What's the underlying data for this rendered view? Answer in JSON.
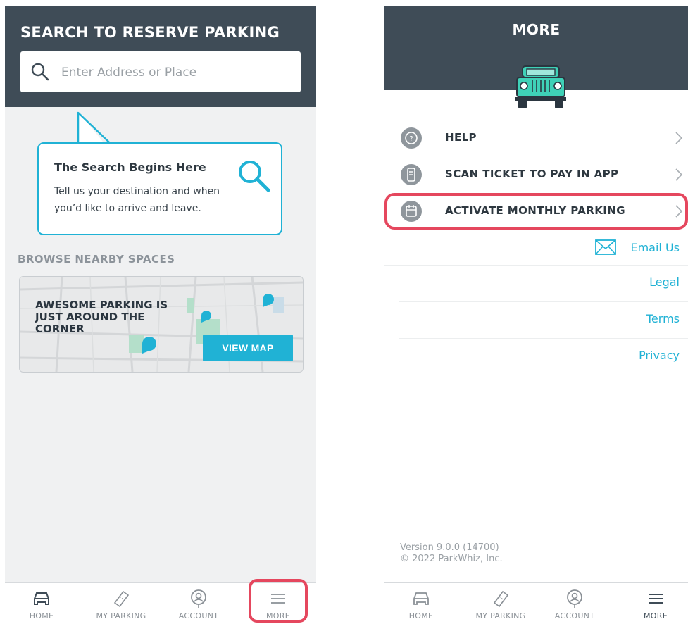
{
  "left": {
    "header_title": "SEARCH TO RESERVE PARKING",
    "search_placeholder": "Enter Address or Place",
    "tip_title": "The Search Begins Here",
    "tip_text": "Tell us your destination and when you’d like to arrive and leave.",
    "browse_title": "BROWSE NEARBY SPACES",
    "map_headline": "AWESOME PARKING IS JUST AROUND THE CORNER",
    "view_map_label": "VIEW MAP"
  },
  "right": {
    "header_title": "MORE",
    "menu": [
      {
        "label": "HELP",
        "icon": "help-icon"
      },
      {
        "label": "SCAN TICKET TO PAY IN APP",
        "icon": "scan-ticket-icon"
      },
      {
        "label": "ACTIVATE MONTHLY PARKING",
        "icon": "monthly-parking-icon"
      }
    ],
    "email_label": "Email Us",
    "links": [
      "Legal",
      "Terms",
      "Privacy"
    ],
    "version": "Version 9.0.0 (14700)",
    "copyright": "© 2022 ParkWhiz, Inc."
  },
  "tabs": [
    {
      "label": "HOME",
      "icon": "car-icon"
    },
    {
      "label": "MY PARKING",
      "icon": "ticket-icon"
    },
    {
      "label": "ACCOUNT",
      "icon": "account-icon"
    },
    {
      "label": "MORE",
      "icon": "menu-icon"
    }
  ],
  "colors": {
    "header": "#3f4c57",
    "accent": "#20b2d5",
    "highlight": "#e5475e"
  }
}
